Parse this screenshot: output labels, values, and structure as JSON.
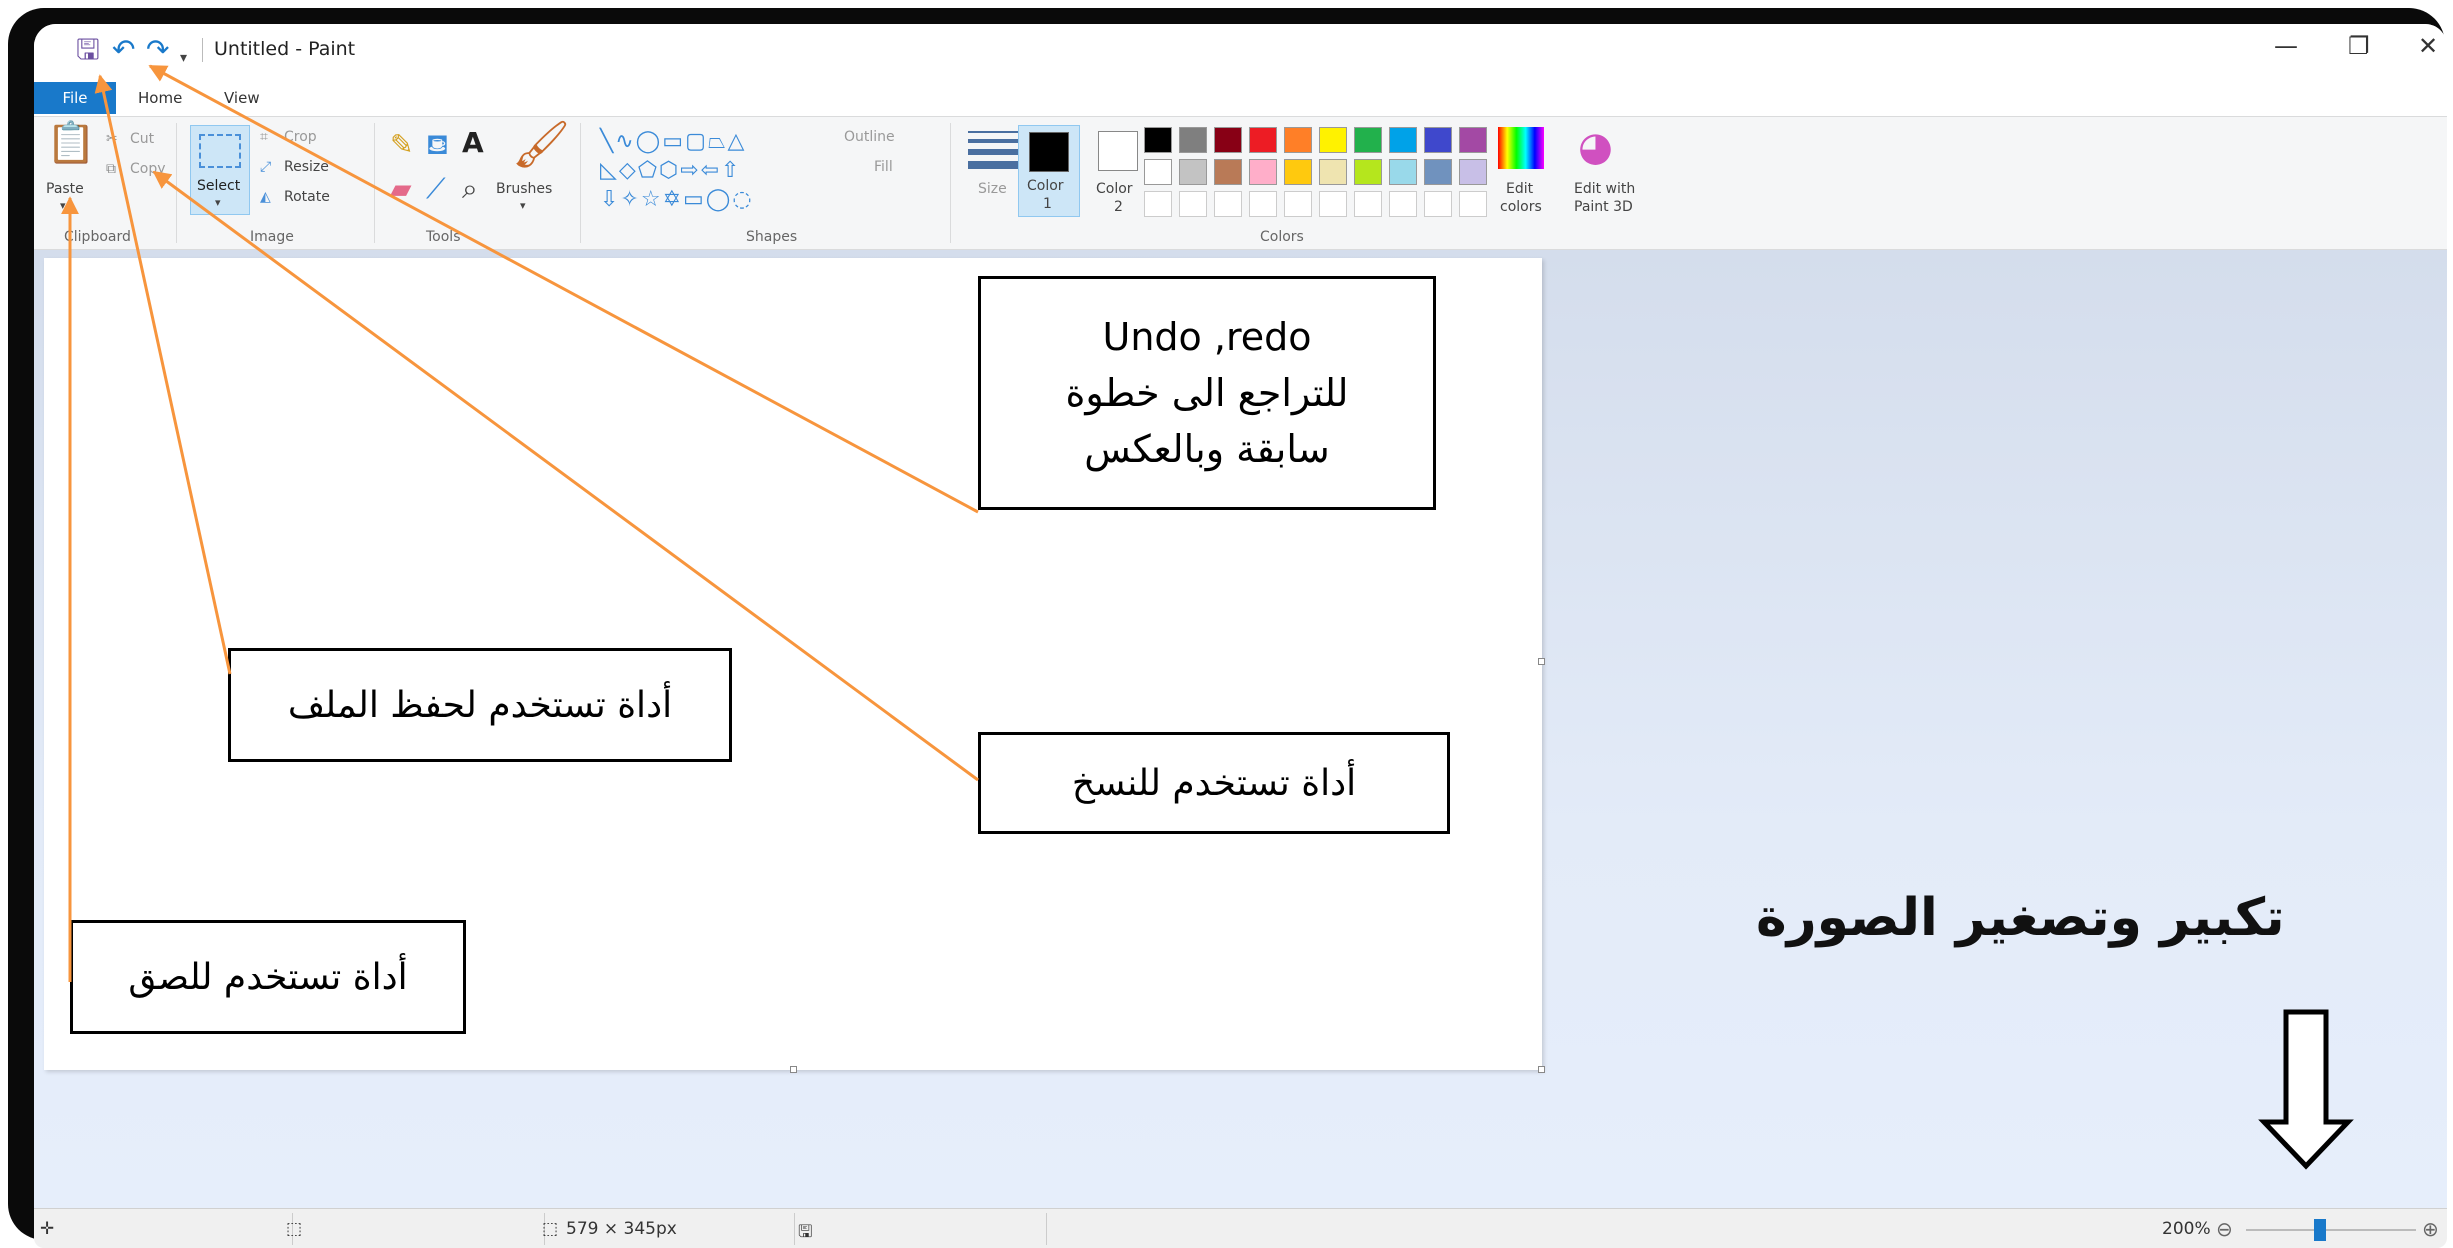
{
  "window": {
    "title": "Untitled - Paint",
    "minimize": "—",
    "restore": "❐",
    "close": "✕"
  },
  "tabs": {
    "file": "File",
    "home": "Home",
    "view": "View"
  },
  "ribbon": {
    "clipboard": {
      "paste": "Paste",
      "cut": "Cut",
      "copy": "Copy",
      "label": "Clipboard"
    },
    "image": {
      "select": "Select",
      "crop": "Crop",
      "resize": "Resize",
      "rotate": "Rotate",
      "label": "Image"
    },
    "tools": {
      "brushes": "Brushes",
      "label": "Tools"
    },
    "shapes": {
      "outline": "Outline",
      "fill": "Fill",
      "label": "Shapes"
    },
    "size": {
      "label": "Size"
    },
    "colors": {
      "color1": "Color",
      "color1_n": "1",
      "color2": "Color",
      "color2_n": "2",
      "edit_colors": "Edit",
      "edit_colors_2": "colors",
      "edit_3d": "Edit with",
      "edit_3d_2": "Paint 3D",
      "label": "Colors",
      "row1": [
        "#000000",
        "#7f7f7f",
        "#880015",
        "#ed1c24",
        "#ff7f27",
        "#fff200",
        "#22b14c",
        "#00a2e8",
        "#3f48cc",
        "#a349a4"
      ],
      "row2": [
        "#ffffff",
        "#c3c3c3",
        "#b97a57",
        "#ffaec9",
        "#ffc90e",
        "#efe4b0",
        "#b5e61d",
        "#99d9ea",
        "#7092be",
        "#c8bfe7"
      ]
    }
  },
  "status": {
    "dimensions": "579 × 345px",
    "zoom": "200%"
  },
  "annotations": {
    "undo_redo_1": "Undo ,redo",
    "undo_redo_2": "للتراجع الى خطوة",
    "undo_redo_3": "سابقة وبالعكس",
    "save": "أداة تستخدم لحفظ الملف",
    "copy": "أداة تستخدم  للنسخ",
    "paste": "أداة تستخدم للصق",
    "zoom": "تكبير وتصغير الصورة"
  },
  "accent": "#f7953d"
}
